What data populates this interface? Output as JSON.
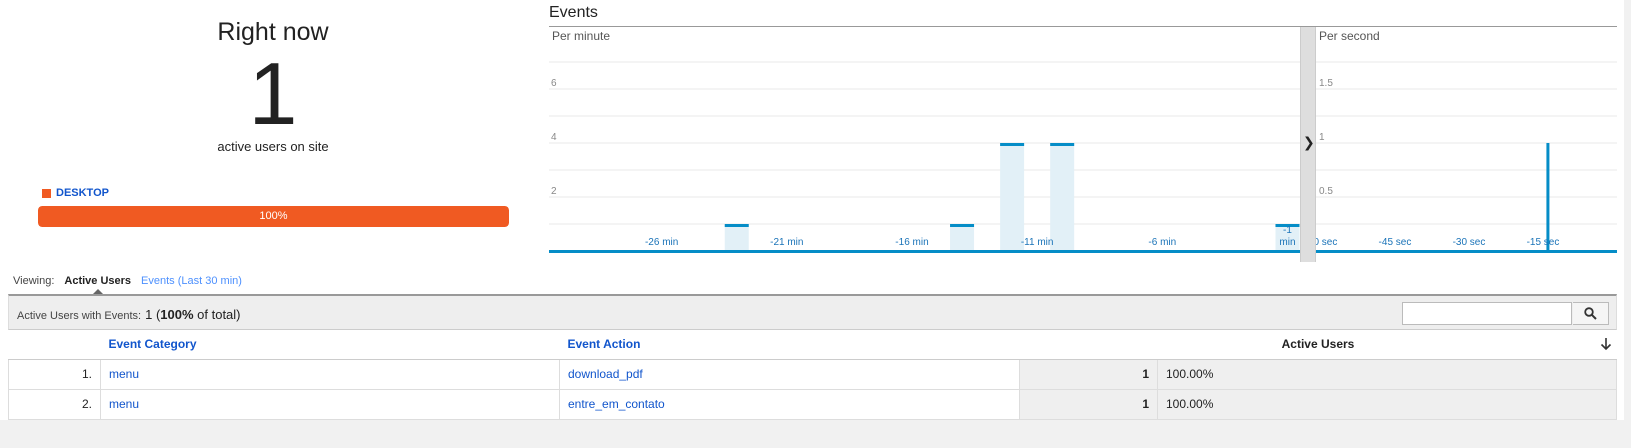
{
  "right_now": {
    "title": "Right now",
    "count": "1",
    "subtitle": "active users on site",
    "device_label": "DESKTOP",
    "device_percent_label": "100%",
    "device_fraction": 1.0,
    "device_color": "#f05a22"
  },
  "events": {
    "title": "Events",
    "per_minute_label": "Per minute",
    "per_second_label": "Per second",
    "expand_icon": "chevron-right-icon"
  },
  "chart_data": [
    {
      "type": "bar",
      "title": "Per minute",
      "ylim": [
        0,
        8
      ],
      "yticks": [
        "2",
        "4",
        "6"
      ],
      "ytick_values": [
        2,
        4,
        6
      ],
      "xticks": [
        "-26 min",
        "-21 min",
        "-16 min",
        "-11 min",
        "-6 min",
        "-1 min"
      ],
      "xtick_values": [
        -26,
        -21,
        -16,
        -11,
        -6,
        -1
      ],
      "x": [
        -30,
        -29,
        -28,
        -27,
        -26,
        -25,
        -24,
        -23,
        -22,
        -21,
        -20,
        -19,
        -18,
        -17,
        -16,
        -15,
        -14,
        -13,
        -12,
        -11,
        -10,
        -9,
        -8,
        -7,
        -6,
        -5,
        -4,
        -3,
        -2,
        -1
      ],
      "values": [
        0,
        0,
        0,
        0,
        0,
        0,
        0,
        1,
        0,
        0,
        0,
        0,
        0,
        0,
        0,
        0,
        1,
        0,
        4,
        0,
        4,
        0,
        0,
        0,
        0,
        0,
        0,
        0,
        0,
        1
      ],
      "bar_color": "#058dc7",
      "grid": true
    },
    {
      "type": "bar",
      "title": "Per second",
      "ylim": [
        0,
        2
      ],
      "yticks": [
        "0.5",
        "1",
        "1.5"
      ],
      "ytick_values": [
        0.5,
        1,
        1.5
      ],
      "xticks": [
        "-60 sec",
        "-45 sec",
        "-30 sec",
        "-15 sec"
      ],
      "xtick_values": [
        -60,
        -45,
        -30,
        -15
      ],
      "x": [
        -14
      ],
      "values": [
        1
      ],
      "xlim": [
        -61,
        0
      ],
      "bar_color": "#058dc7",
      "grid": true
    }
  ],
  "viewing": {
    "label": "Viewing:",
    "tab_active": "Active Users",
    "tab_other": "Events (Last 30 min)"
  },
  "summary": {
    "label": "Active Users with Events:",
    "value_count": "1",
    "value_open": " (",
    "value_pct": "100%",
    "value_close": " of total)"
  },
  "search": {
    "placeholder": "",
    "icon": "search-icon"
  },
  "table": {
    "headers": {
      "category": "Event Category",
      "action": "Event Action",
      "users": "Active Users"
    },
    "rows": [
      {
        "idx": "1.",
        "category": "menu",
        "action": "download_pdf",
        "users": "1",
        "pct": "100.00%"
      },
      {
        "idx": "2.",
        "category": "menu",
        "action": "entre_em_contato",
        "users": "1",
        "pct": "100.00%"
      }
    ]
  }
}
